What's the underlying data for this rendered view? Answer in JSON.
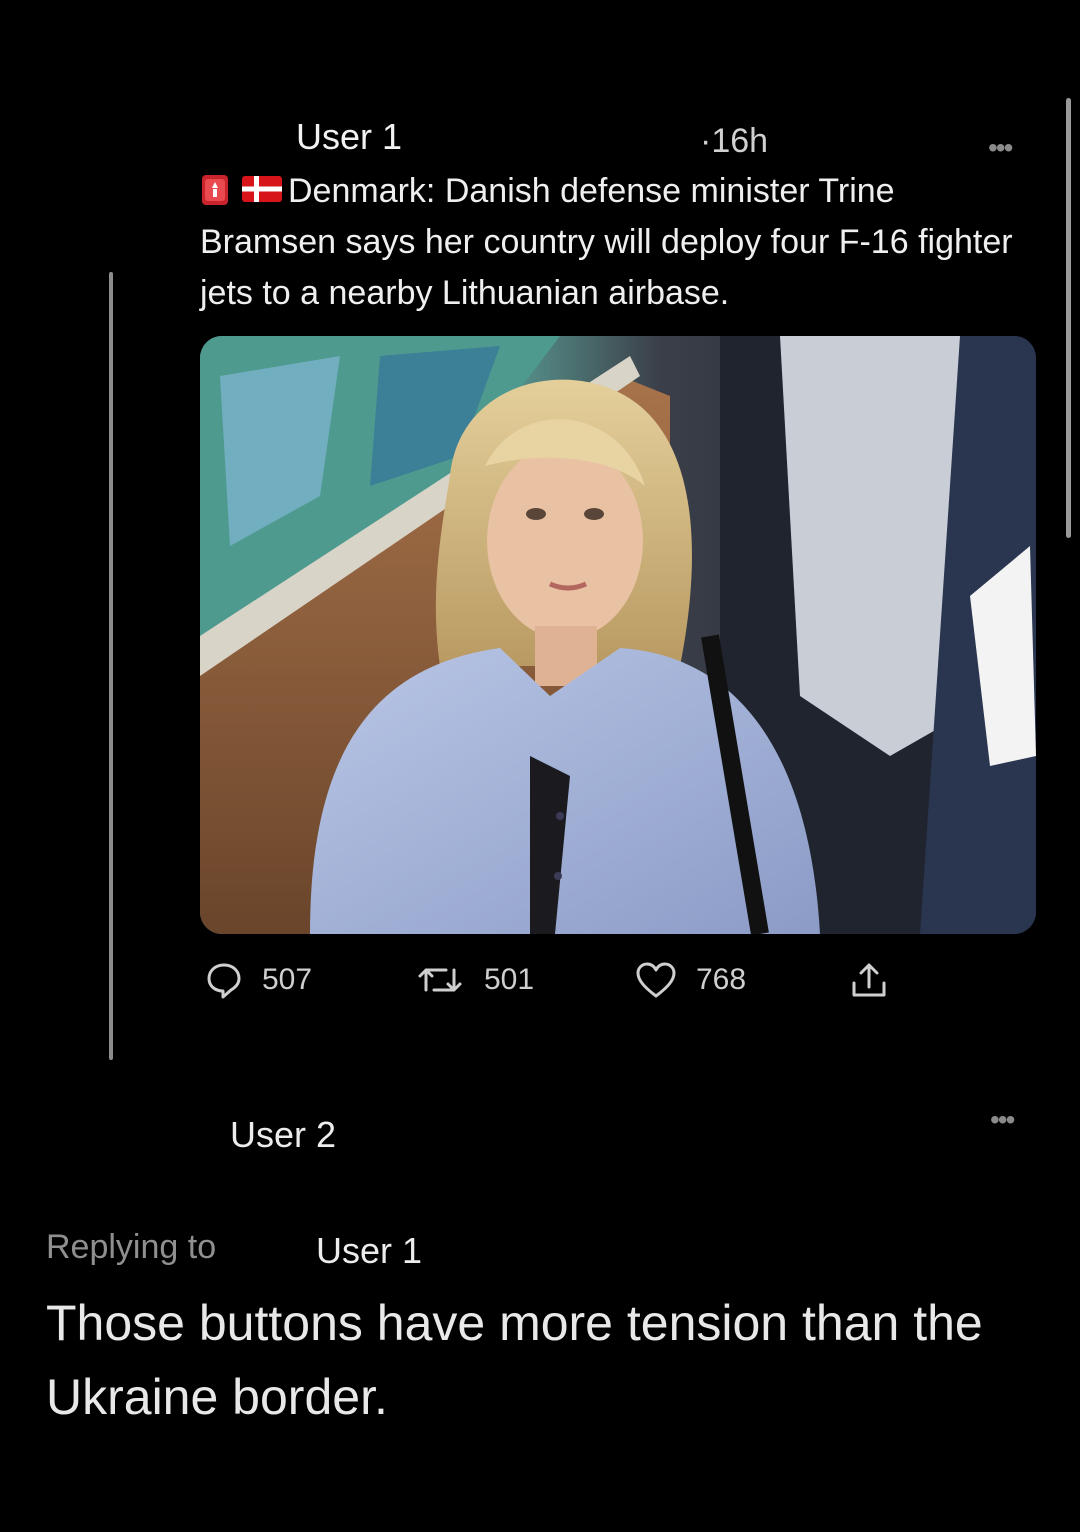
{
  "tweet": {
    "author": "User 1",
    "time": "16h",
    "time_prefix": "·",
    "more_icon": "more-horizontal-icon",
    "text": "Denmark: Danish defense minister Trine Bramsen says her country will deploy four F-16 fighter jets to a nearby Lithuanian airbase.",
    "emojis": [
      "rotating-light-icon",
      "denmark-flag-icon"
    ],
    "image_alt": "woman-in-blue-shirt-photo",
    "actions": {
      "replies": "507",
      "retweets": "501",
      "likes": "768"
    }
  },
  "reply": {
    "author": "User 2",
    "replying_to_label": "Replying to",
    "replying_to_user": "User 1",
    "text": "Those buttons have more tension than the Ukraine border."
  },
  "colors": {
    "background": "#000000",
    "text": "#ececec",
    "muted": "#8f8f8f"
  }
}
